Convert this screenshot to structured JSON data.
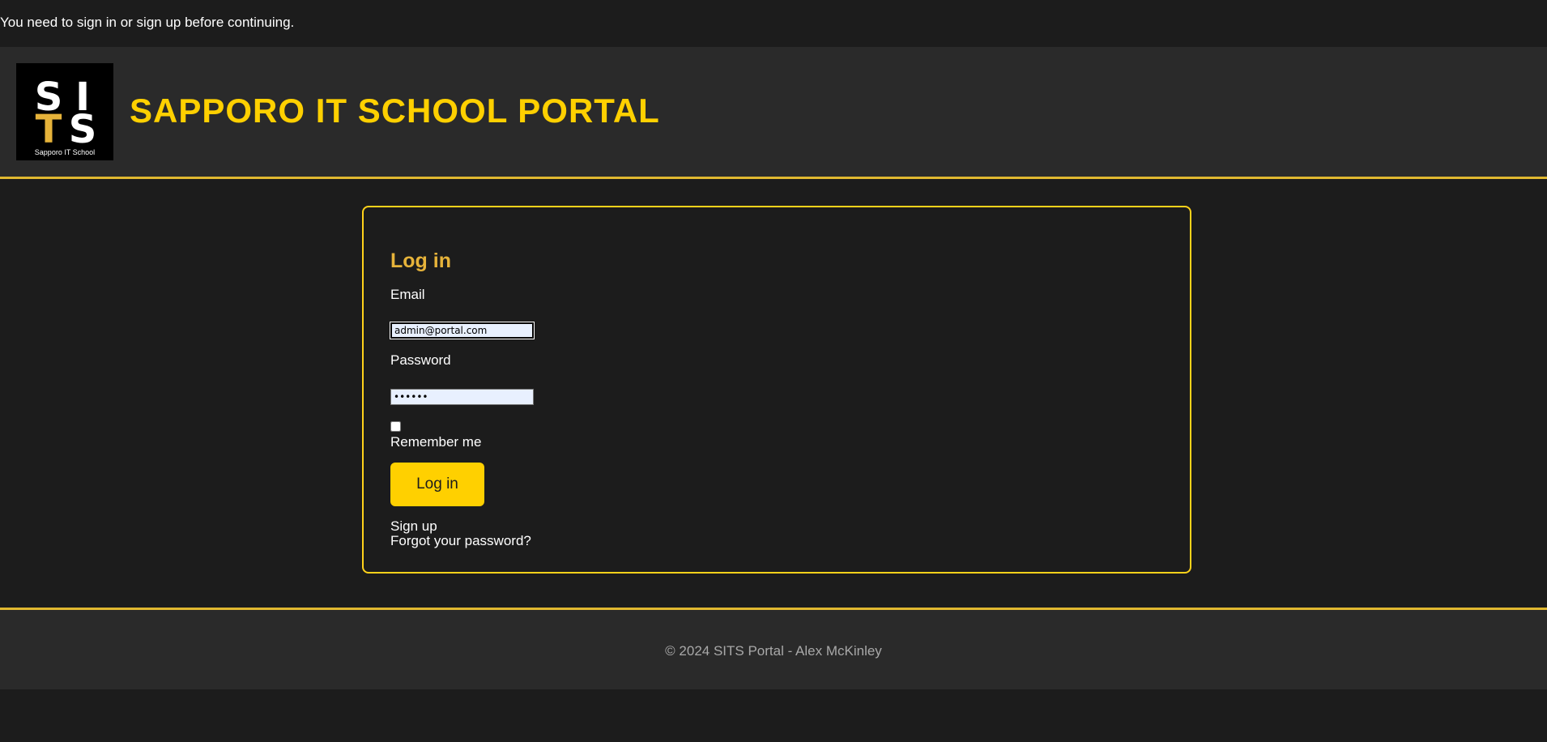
{
  "flash": {
    "message": "You need to sign in or sign up before continuing."
  },
  "header": {
    "logo": {
      "big_letters_top": [
        "S",
        "I"
      ],
      "big_letters_bottom": [
        "T",
        "S"
      ],
      "caption": "Sapporo IT School"
    },
    "title": "SAPPORO IT SCHOOL PORTAL"
  },
  "login": {
    "title": "Log in",
    "email_label": "Email",
    "email_value": "admin@portal.com",
    "password_label": "Password",
    "password_value": "••••••",
    "remember_label": "Remember me",
    "remember_checked": false,
    "submit_label": "Log in",
    "signup_link": "Sign up",
    "forgot_link": "Forgot your password?"
  },
  "footer": {
    "text": "© 2024 SITS Portal - Alex McKinley"
  },
  "colors": {
    "accent": "#ffd000",
    "accent_border": "#e0b830",
    "login_title": "#e6b33a",
    "background": "#1c1c1c",
    "panel": "#2a2a2a"
  }
}
